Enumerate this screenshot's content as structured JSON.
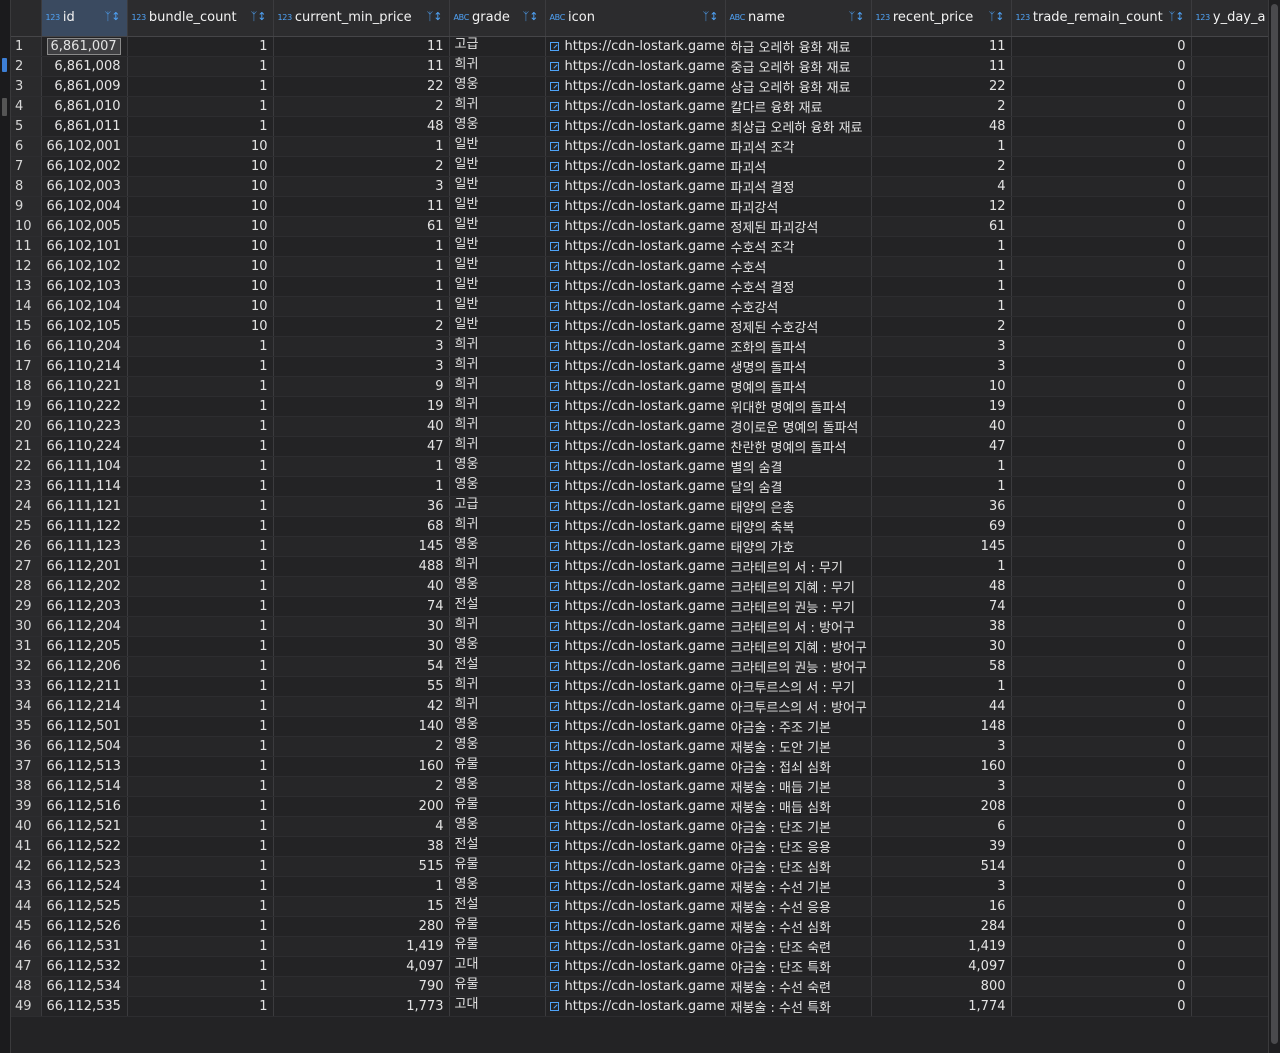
{
  "columns": [
    {
      "key": "rownum",
      "label": "",
      "type": ""
    },
    {
      "key": "id",
      "label": "id",
      "type": "123"
    },
    {
      "key": "bundle_count",
      "label": "bundle_count",
      "type": "123"
    },
    {
      "key": "current_min_price",
      "label": "current_min_price",
      "type": "123"
    },
    {
      "key": "grade",
      "label": "grade",
      "type": "ABC"
    },
    {
      "key": "icon",
      "label": "icon",
      "type": "ABC"
    },
    {
      "key": "name",
      "label": "name",
      "type": "ABC"
    },
    {
      "key": "recent_price",
      "label": "recent_price",
      "type": "123"
    },
    {
      "key": "trade_remain_count",
      "label": "trade_remain_count",
      "type": "123"
    },
    {
      "key": "y_day",
      "label": "y_day_a",
      "type": "123"
    }
  ],
  "filter_icon": "filter-sort-icon",
  "icon_prefix": "https://cdn-lostark.game.",
  "rows": [
    {
      "n": "1",
      "id": "6,861,007",
      "bc": "1",
      "cmp": "11",
      "grade": "고급",
      "name": "하급 오레하 융화 재료",
      "rp": "11",
      "trc": "0"
    },
    {
      "n": "2",
      "id": "6,861,008",
      "bc": "1",
      "cmp": "11",
      "grade": "희귀",
      "name": "중급 오레하 융화 재료",
      "rp": "11",
      "trc": "0"
    },
    {
      "n": "3",
      "id": "6,861,009",
      "bc": "1",
      "cmp": "22",
      "grade": "영웅",
      "name": "상급 오레하 융화 재료",
      "rp": "22",
      "trc": "0"
    },
    {
      "n": "4",
      "id": "6,861,010",
      "bc": "1",
      "cmp": "2",
      "grade": "희귀",
      "name": "칼다르 융화 재료",
      "rp": "2",
      "trc": "0"
    },
    {
      "n": "5",
      "id": "6,861,011",
      "bc": "1",
      "cmp": "48",
      "grade": "영웅",
      "name": "최상급 오레하 융화 재료",
      "rp": "48",
      "trc": "0"
    },
    {
      "n": "6",
      "id": "66,102,001",
      "bc": "10",
      "cmp": "1",
      "grade": "일반",
      "name": "파괴석 조각",
      "rp": "1",
      "trc": "0"
    },
    {
      "n": "7",
      "id": "66,102,002",
      "bc": "10",
      "cmp": "2",
      "grade": "일반",
      "name": "파괴석",
      "rp": "2",
      "trc": "0"
    },
    {
      "n": "8",
      "id": "66,102,003",
      "bc": "10",
      "cmp": "3",
      "grade": "일반",
      "name": "파괴석 결정",
      "rp": "4",
      "trc": "0"
    },
    {
      "n": "9",
      "id": "66,102,004",
      "bc": "10",
      "cmp": "11",
      "grade": "일반",
      "name": "파괴강석",
      "rp": "12",
      "trc": "0"
    },
    {
      "n": "10",
      "id": "66,102,005",
      "bc": "10",
      "cmp": "61",
      "grade": "일반",
      "name": "정제된 파괴강석",
      "rp": "61",
      "trc": "0"
    },
    {
      "n": "11",
      "id": "66,102,101",
      "bc": "10",
      "cmp": "1",
      "grade": "일반",
      "name": "수호석 조각",
      "rp": "1",
      "trc": "0"
    },
    {
      "n": "12",
      "id": "66,102,102",
      "bc": "10",
      "cmp": "1",
      "grade": "일반",
      "name": "수호석",
      "rp": "1",
      "trc": "0"
    },
    {
      "n": "13",
      "id": "66,102,103",
      "bc": "10",
      "cmp": "1",
      "grade": "일반",
      "name": "수호석 결정",
      "rp": "1",
      "trc": "0"
    },
    {
      "n": "14",
      "id": "66,102,104",
      "bc": "10",
      "cmp": "1",
      "grade": "일반",
      "name": "수호강석",
      "rp": "1",
      "trc": "0"
    },
    {
      "n": "15",
      "id": "66,102,105",
      "bc": "10",
      "cmp": "2",
      "grade": "일반",
      "name": "정제된 수호강석",
      "rp": "2",
      "trc": "0"
    },
    {
      "n": "16",
      "id": "66,110,204",
      "bc": "1",
      "cmp": "3",
      "grade": "희귀",
      "name": "조화의 돌파석",
      "rp": "3",
      "trc": "0"
    },
    {
      "n": "17",
      "id": "66,110,214",
      "bc": "1",
      "cmp": "3",
      "grade": "희귀",
      "name": "생명의 돌파석",
      "rp": "3",
      "trc": "0"
    },
    {
      "n": "18",
      "id": "66,110,221",
      "bc": "1",
      "cmp": "9",
      "grade": "희귀",
      "name": "명예의 돌파석",
      "rp": "10",
      "trc": "0"
    },
    {
      "n": "19",
      "id": "66,110,222",
      "bc": "1",
      "cmp": "19",
      "grade": "희귀",
      "name": "위대한 명예의 돌파석",
      "rp": "19",
      "trc": "0"
    },
    {
      "n": "20",
      "id": "66,110,223",
      "bc": "1",
      "cmp": "40",
      "grade": "희귀",
      "name": "경이로운 명예의 돌파석",
      "rp": "40",
      "trc": "0"
    },
    {
      "n": "21",
      "id": "66,110,224",
      "bc": "1",
      "cmp": "47",
      "grade": "희귀",
      "name": "찬란한 명예의 돌파석",
      "rp": "47",
      "trc": "0"
    },
    {
      "n": "22",
      "id": "66,111,104",
      "bc": "1",
      "cmp": "1",
      "grade": "영웅",
      "name": "별의 숨결",
      "rp": "1",
      "trc": "0"
    },
    {
      "n": "23",
      "id": "66,111,114",
      "bc": "1",
      "cmp": "1",
      "grade": "영웅",
      "name": "달의 숨결",
      "rp": "1",
      "trc": "0"
    },
    {
      "n": "24",
      "id": "66,111,121",
      "bc": "1",
      "cmp": "36",
      "grade": "고급",
      "name": "태양의 은총",
      "rp": "36",
      "trc": "0"
    },
    {
      "n": "25",
      "id": "66,111,122",
      "bc": "1",
      "cmp": "68",
      "grade": "희귀",
      "name": "태양의 축복",
      "rp": "69",
      "trc": "0"
    },
    {
      "n": "26",
      "id": "66,111,123",
      "bc": "1",
      "cmp": "145",
      "grade": "영웅",
      "name": "태양의 가호",
      "rp": "145",
      "trc": "0"
    },
    {
      "n": "27",
      "id": "66,112,201",
      "bc": "1",
      "cmp": "488",
      "grade": "희귀",
      "name": "크라테르의 서 : 무기",
      "rp": "1",
      "trc": "0"
    },
    {
      "n": "28",
      "id": "66,112,202",
      "bc": "1",
      "cmp": "40",
      "grade": "영웅",
      "name": "크라테르의 지혜 : 무기",
      "rp": "48",
      "trc": "0"
    },
    {
      "n": "29",
      "id": "66,112,203",
      "bc": "1",
      "cmp": "74",
      "grade": "전설",
      "name": "크라테르의 권능 : 무기",
      "rp": "74",
      "trc": "0"
    },
    {
      "n": "30",
      "id": "66,112,204",
      "bc": "1",
      "cmp": "30",
      "grade": "희귀",
      "name": "크라테르의 서 : 방어구",
      "rp": "38",
      "trc": "0"
    },
    {
      "n": "31",
      "id": "66,112,205",
      "bc": "1",
      "cmp": "30",
      "grade": "영웅",
      "name": "크라테르의 지혜 : 방어구",
      "rp": "30",
      "trc": "0"
    },
    {
      "n": "32",
      "id": "66,112,206",
      "bc": "1",
      "cmp": "54",
      "grade": "전설",
      "name": "크라테르의 권능 : 방어구",
      "rp": "58",
      "trc": "0"
    },
    {
      "n": "33",
      "id": "66,112,211",
      "bc": "1",
      "cmp": "55",
      "grade": "희귀",
      "name": "아크투르스의 서 : 무기",
      "rp": "1",
      "trc": "0"
    },
    {
      "n": "34",
      "id": "66,112,214",
      "bc": "1",
      "cmp": "42",
      "grade": "희귀",
      "name": "아크투르스의 서 : 방어구",
      "rp": "44",
      "trc": "0"
    },
    {
      "n": "35",
      "id": "66,112,501",
      "bc": "1",
      "cmp": "140",
      "grade": "영웅",
      "name": "야금술 : 주조 기본",
      "rp": "148",
      "trc": "0"
    },
    {
      "n": "36",
      "id": "66,112,504",
      "bc": "1",
      "cmp": "2",
      "grade": "영웅",
      "name": "재봉술 : 도안 기본",
      "rp": "3",
      "trc": "0"
    },
    {
      "n": "37",
      "id": "66,112,513",
      "bc": "1",
      "cmp": "160",
      "grade": "유물",
      "name": "야금술 : 접쇠 심화",
      "rp": "160",
      "trc": "0"
    },
    {
      "n": "38",
      "id": "66,112,514",
      "bc": "1",
      "cmp": "2",
      "grade": "영웅",
      "name": "재봉술 : 매듭 기본",
      "rp": "3",
      "trc": "0"
    },
    {
      "n": "39",
      "id": "66,112,516",
      "bc": "1",
      "cmp": "200",
      "grade": "유물",
      "name": "재봉술 : 매듭 심화",
      "rp": "208",
      "trc": "0"
    },
    {
      "n": "40",
      "id": "66,112,521",
      "bc": "1",
      "cmp": "4",
      "grade": "영웅",
      "name": "야금술 : 단조 기본",
      "rp": "6",
      "trc": "0"
    },
    {
      "n": "41",
      "id": "66,112,522",
      "bc": "1",
      "cmp": "38",
      "grade": "전설",
      "name": "야금술 : 단조 응용",
      "rp": "39",
      "trc": "0"
    },
    {
      "n": "42",
      "id": "66,112,523",
      "bc": "1",
      "cmp": "515",
      "grade": "유물",
      "name": "야금술 : 단조 심화",
      "rp": "514",
      "trc": "0"
    },
    {
      "n": "43",
      "id": "66,112,524",
      "bc": "1",
      "cmp": "1",
      "grade": "영웅",
      "name": "재봉술 : 수선 기본",
      "rp": "3",
      "trc": "0"
    },
    {
      "n": "44",
      "id": "66,112,525",
      "bc": "1",
      "cmp": "15",
      "grade": "전설",
      "name": "재봉술 : 수선 응용",
      "rp": "16",
      "trc": "0"
    },
    {
      "n": "45",
      "id": "66,112,526",
      "bc": "1",
      "cmp": "280",
      "grade": "유물",
      "name": "재봉술 : 수선 심화",
      "rp": "284",
      "trc": "0"
    },
    {
      "n": "46",
      "id": "66,112,531",
      "bc": "1",
      "cmp": "1,419",
      "grade": "유물",
      "name": "야금술 : 단조 숙련",
      "rp": "1,419",
      "trc": "0"
    },
    {
      "n": "47",
      "id": "66,112,532",
      "bc": "1",
      "cmp": "4,097",
      "grade": "고대",
      "name": "야금술 : 단조 특화",
      "rp": "4,097",
      "trc": "0"
    },
    {
      "n": "48",
      "id": "66,112,534",
      "bc": "1",
      "cmp": "790",
      "grade": "유물",
      "name": "재봉술 : 수선 숙련",
      "rp": "800",
      "trc": "0"
    },
    {
      "n": "49",
      "id": "66,112,535",
      "bc": "1",
      "cmp": "1,773",
      "grade": "고대",
      "name": "재봉술 : 수선 특화",
      "rp": "1,774",
      "trc": "0"
    }
  ]
}
